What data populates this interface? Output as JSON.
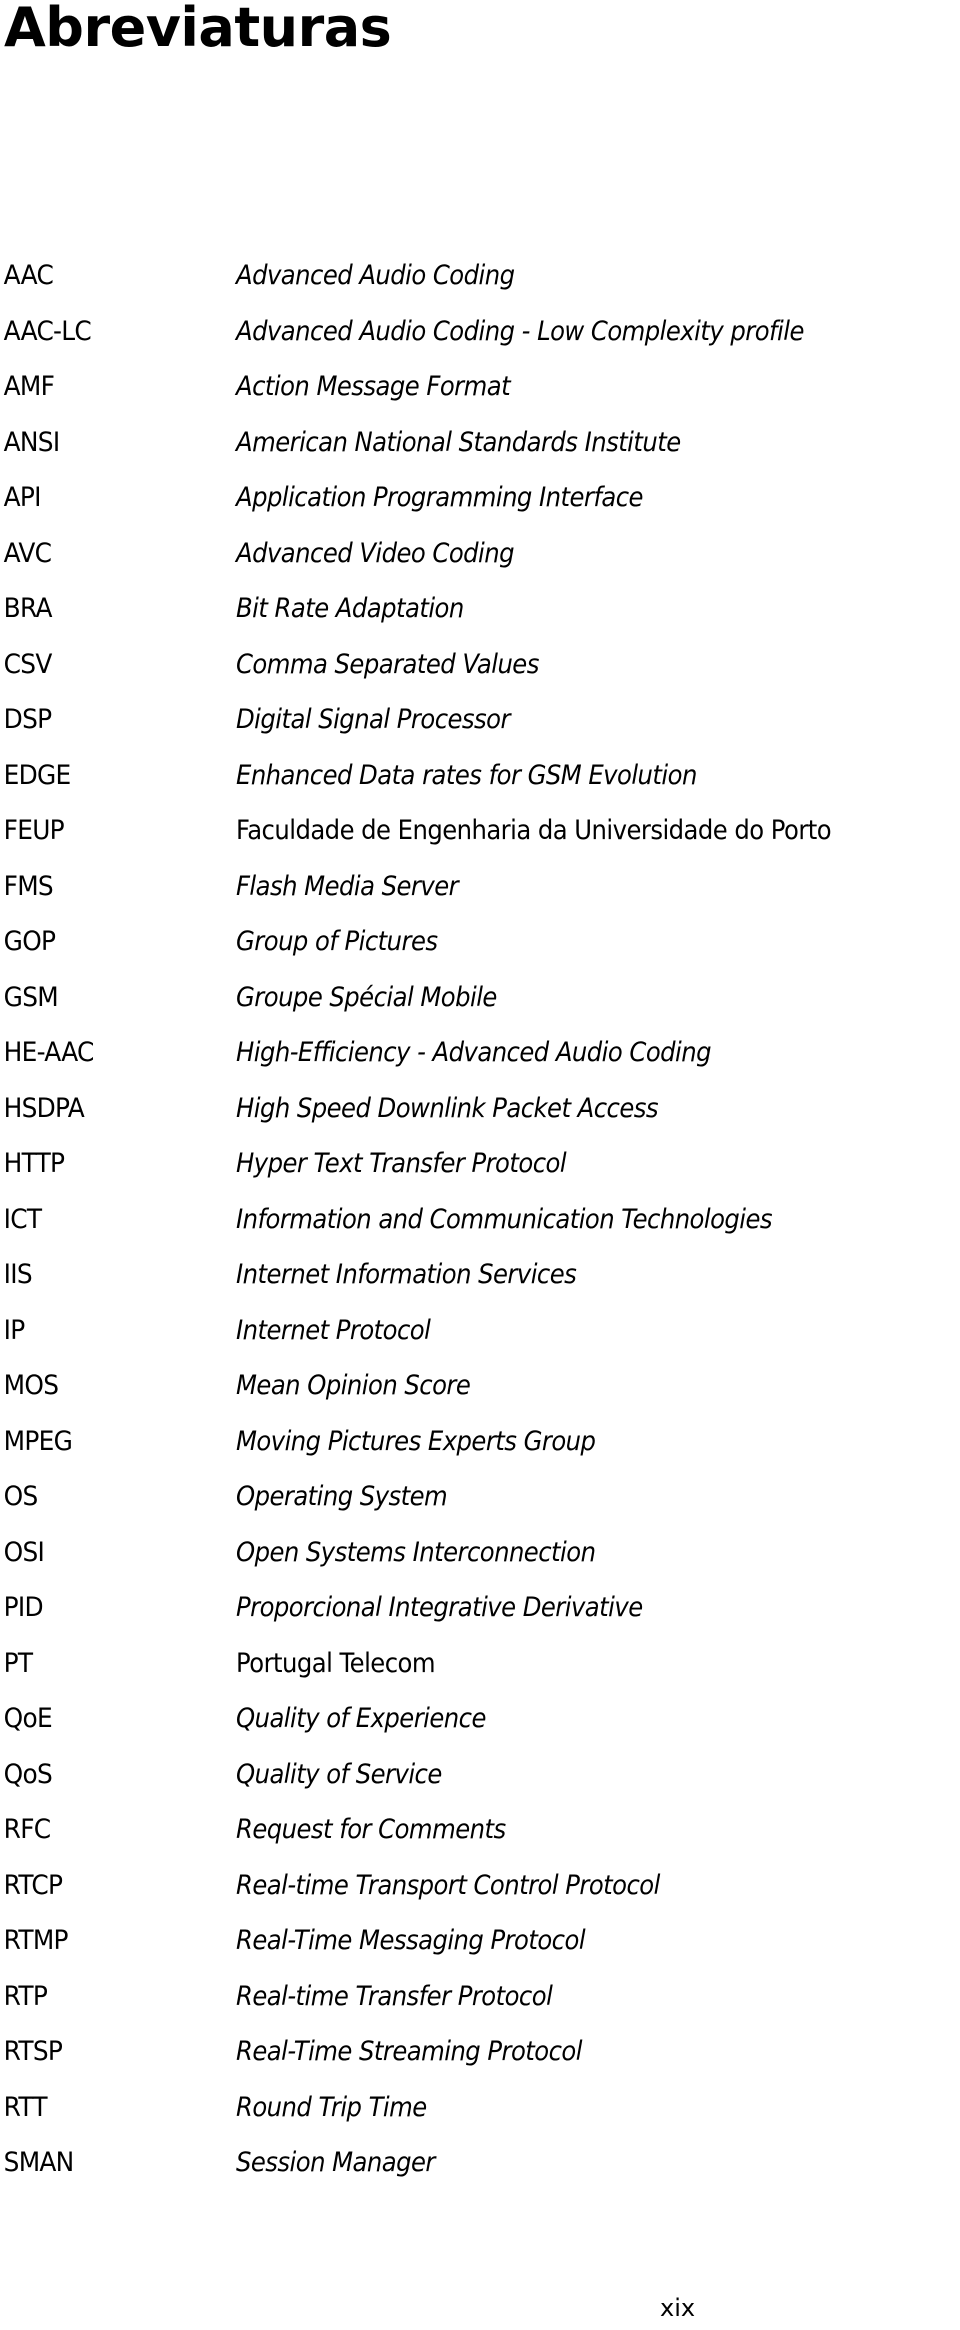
{
  "page": {
    "title": "Abreviaturas",
    "page_number": "xix"
  },
  "abbreviations": [
    {
      "term": "AAC",
      "definition": "Advanced Audio Coding",
      "italic": true
    },
    {
      "term": "AAC-LC",
      "definition": "Advanced Audio Coding - Low Complexity profile",
      "italic": true
    },
    {
      "term": "AMF",
      "definition": "Action Message Format",
      "italic": true
    },
    {
      "term": "ANSI",
      "definition": "American National Standards Institute",
      "italic": true
    },
    {
      "term": "API",
      "definition": "Application Programming Interface",
      "italic": true
    },
    {
      "term": "AVC",
      "definition": "Advanced Video Coding",
      "italic": true
    },
    {
      "term": "BRA",
      "definition": "Bit Rate Adaptation",
      "italic": true
    },
    {
      "term": "CSV",
      "definition": "Comma Separated Values",
      "italic": true
    },
    {
      "term": "DSP",
      "definition": "Digital Signal Processor",
      "italic": true
    },
    {
      "term": "EDGE",
      "definition": "Enhanced Data rates for GSM Evolution",
      "italic": true
    },
    {
      "term": "FEUP",
      "definition": "Faculdade de Engenharia da Universidade do Porto",
      "italic": false
    },
    {
      "term": "FMS",
      "definition": "Flash Media Server",
      "italic": true
    },
    {
      "term": "GOP",
      "definition": "Group of Pictures",
      "italic": true
    },
    {
      "term": "GSM",
      "definition": "Groupe Spécial Mobile",
      "italic": true
    },
    {
      "term": "HE-AAC",
      "definition": "High-Efficiency - Advanced Audio Coding",
      "italic": true
    },
    {
      "term": "HSDPA",
      "definition": "High Speed Downlink Packet Access",
      "italic": true
    },
    {
      "term": "HTTP",
      "definition": "Hyper Text Transfer Protocol",
      "italic": true
    },
    {
      "term": "ICT",
      "definition": "Information and Communication Technologies",
      "italic": true
    },
    {
      "term": "IIS",
      "definition": "Internet Information Services",
      "italic": true
    },
    {
      "term": "IP",
      "definition": "Internet Protocol",
      "italic": true
    },
    {
      "term": "MOS",
      "definition": "Mean Opinion Score",
      "italic": true
    },
    {
      "term": "MPEG",
      "definition": "Moving Pictures Experts Group",
      "italic": true
    },
    {
      "term": "OS",
      "definition": "Operating System",
      "italic": true
    },
    {
      "term": "OSI",
      "definition": "Open Systems Interconnection",
      "italic": true
    },
    {
      "term": "PID",
      "definition": "Proporcional Integrative Derivative",
      "italic": true
    },
    {
      "term": "PT",
      "definition": "Portugal Telecom",
      "italic": false
    },
    {
      "term": "QoE",
      "definition": "Quality of Experience",
      "italic": true
    },
    {
      "term": "QoS",
      "definition": "Quality of Service",
      "italic": true
    },
    {
      "term": "RFC",
      "definition": "Request for Comments",
      "italic": true
    },
    {
      "term": "RTCP",
      "definition": "Real-time Transport Control Protocol",
      "italic": true
    },
    {
      "term": "RTMP",
      "definition": "Real-Time Messaging Protocol",
      "italic": true
    },
    {
      "term": "RTP",
      "definition": "Real-time Transfer Protocol",
      "italic": true
    },
    {
      "term": "RTSP",
      "definition": "Real-Time Streaming Protocol",
      "italic": true
    },
    {
      "term": "RTT",
      "definition": "Round Trip Time",
      "italic": true
    },
    {
      "term": "SMAN",
      "definition": "Session Manager",
      "italic": true
    }
  ]
}
